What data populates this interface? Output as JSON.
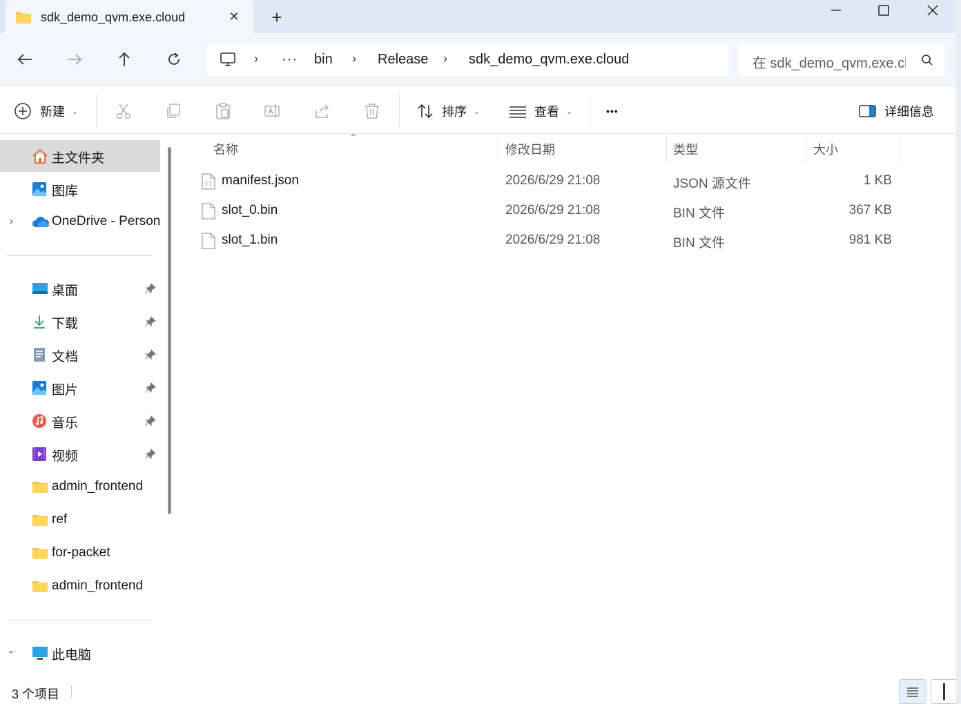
{
  "window": {
    "tab_title": "sdk_demo_qvm.exe.cloud",
    "close_tab": "✕",
    "new_tab": "+"
  },
  "address": {
    "ellipsis": "···",
    "crumbs": [
      "bin",
      "Release",
      "sdk_demo_qvm.exe.cloud"
    ],
    "search_placeholder": "在 sdk_demo_qvm.exe.cloud 中搜索"
  },
  "toolbar": {
    "new_label": "新建",
    "sort_label": "排序",
    "view_label": "查看",
    "more_label": "•••",
    "details_label": "详细信息"
  },
  "sidebar": {
    "home": "主文件夹",
    "gallery": "图库",
    "onedrive": "OneDrive - Person",
    "quick": [
      "桌面",
      "下载",
      "文档",
      "图片",
      "音乐",
      "视频"
    ],
    "folders": [
      "admin_frontend",
      "ref",
      "for-packet",
      "admin_frontend"
    ],
    "thispc": "此电脑"
  },
  "columns": {
    "name": "名称",
    "date": "修改日期",
    "type": "类型",
    "size": "大小"
  },
  "files": [
    {
      "name": "manifest.json",
      "date": "2026/6/29 21:08",
      "type": "JSON 源文件",
      "size": "1 KB"
    },
    {
      "name": "slot_0.bin",
      "date": "2026/6/29 21:08",
      "type": "BIN 文件",
      "size": "367 KB"
    },
    {
      "name": "slot_1.bin",
      "date": "2026/6/29 21:08",
      "type": "BIN 文件",
      "size": "981 KB"
    }
  ],
  "status": {
    "item_count": "3 个项目"
  },
  "colors": {
    "titlebar": "#dfe9f5",
    "navrow": "#f3f6fb",
    "folder_yellow": "#f4c542",
    "accent_blue": "#0067c0"
  }
}
